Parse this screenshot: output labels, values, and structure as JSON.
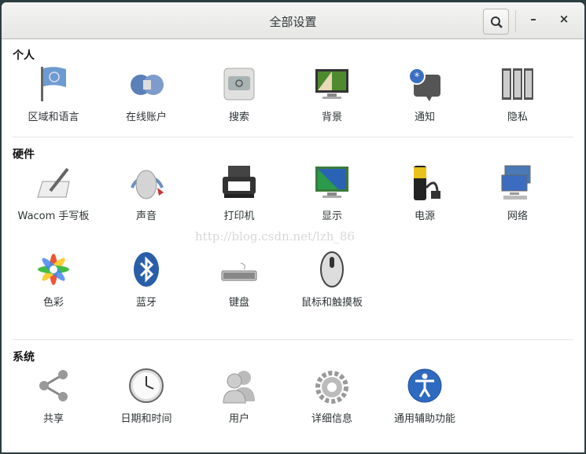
{
  "window": {
    "title": "全部设置",
    "minimize": "–",
    "close": "×"
  },
  "sections": {
    "personal": {
      "title": "个人",
      "items": [
        "区域和语言",
        "在线账户",
        "搜索",
        "背景",
        "通知",
        "隐私"
      ]
    },
    "hardware": {
      "title": "硬件",
      "items": [
        "Wacom 手写板",
        "声音",
        "打印机",
        "显示",
        "电源",
        "网络",
        "色彩",
        "蓝牙",
        "键盘",
        "鼠标和触摸板"
      ]
    },
    "system": {
      "title": "系统",
      "items": [
        "共享",
        "日期和时间",
        "用户",
        "详细信息",
        "通用辅助功能"
      ]
    }
  },
  "watermark": "http://blog.csdn.net/lzh_86"
}
